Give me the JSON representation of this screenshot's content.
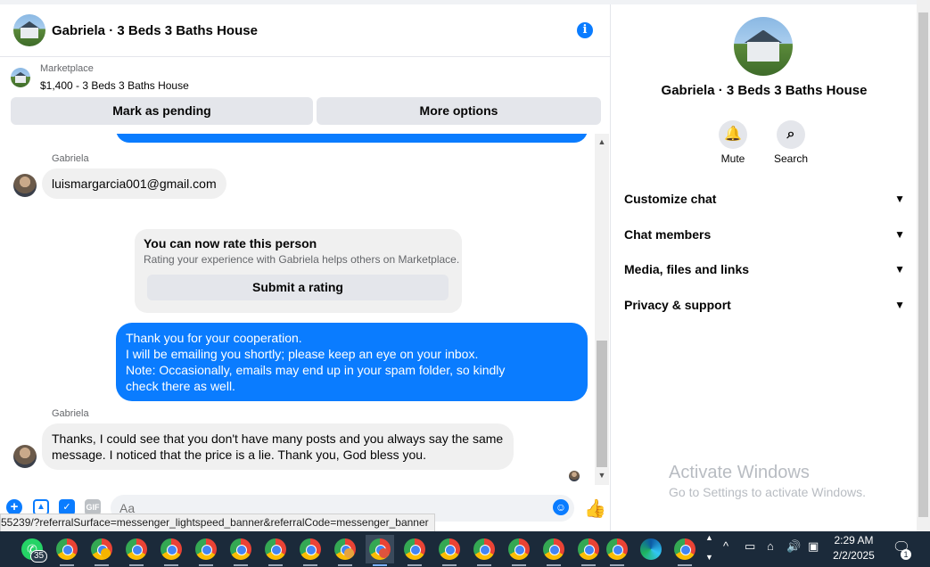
{
  "header": {
    "title": "Gabriela · 3 Beds 3 Baths House",
    "info_icon": "info-icon"
  },
  "listing": {
    "label": "Marketplace",
    "title": "$1,400 - 3 Beds 3 Baths House"
  },
  "actions": {
    "mark_pending": "Mark as pending",
    "more_options": "More options"
  },
  "messages": {
    "sender_1": "Gabriela",
    "email_msg": "luismargarcia001@gmail.com",
    "rate_title": "You can now rate this person",
    "rate_sub": "Rating your experience with Gabriela helps others on Marketplace.",
    "rate_button": "Submit a rating",
    "outgoing_1": "Thank you for your cooperation.",
    "outgoing_2": "I will be emailing you shortly; please keep an eye on your inbox.",
    "outgoing_3": "Note: Occasionally, emails may end up in your spam folder, so kindly",
    "outgoing_4": "check there as well.",
    "sender_2": "Gabriela",
    "reply_1": "Thanks, I could see that you don't have many posts and you always say the same",
    "reply_2": "message. I noticed that the price is a lie. Thank you, God bless you."
  },
  "composer": {
    "placeholder": "Aa",
    "icons": [
      "plus-icon",
      "photo-icon",
      "sticker-icon",
      "gif-icon",
      "emoji-icon",
      "like-icon"
    ],
    "gif_label": "GIF"
  },
  "status_url": "55239/?referralSurface=messenger_lightspeed_banner&referralCode=messenger_banner",
  "right_panel": {
    "title": "Gabriela · 3 Beds 3 Baths House",
    "mute": "Mute",
    "search": "Search",
    "sections": [
      "Customize chat",
      "Chat members",
      "Media, files and links",
      "Privacy & support"
    ]
  },
  "watermark": {
    "line1": "Activate Windows",
    "line2": "Go to Settings to activate Windows."
  },
  "taskbar": {
    "whatsapp_count": "35",
    "time": "2:29 AM",
    "date": "2/2/2025",
    "notification_count": "1"
  },
  "colors": {
    "accent": "#0a7cff",
    "bubble_gray": "#f0f0f0",
    "taskbar": "#1b2a3a"
  }
}
